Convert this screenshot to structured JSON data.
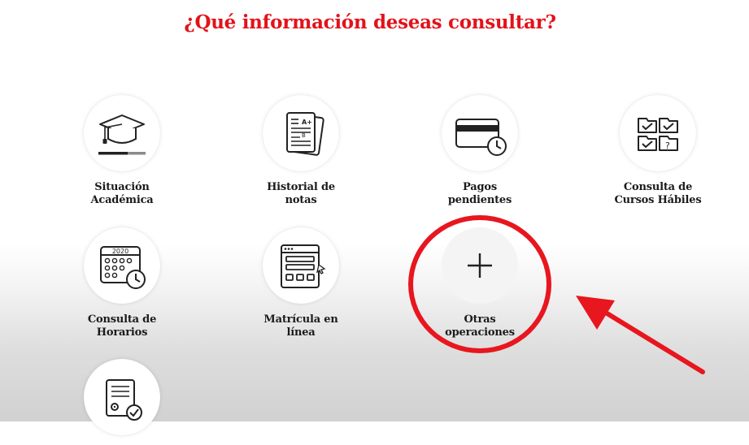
{
  "header": {
    "title": "¿Qué información deseas consultar?"
  },
  "tiles": [
    {
      "label": "Situación\nAcadémica",
      "icon": "graduation-cap-icon"
    },
    {
      "label": "Historial de\nnotas",
      "icon": "document-stack-icon"
    },
    {
      "label": "Pagos\npendientes",
      "icon": "credit-card-clock-icon"
    },
    {
      "label": "Consulta de\nCursos Hábiles",
      "icon": "checklist-folders-icon"
    },
    {
      "label": "Consulta de\nHorarios",
      "icon": "calendar-clock-icon",
      "calendar_year": "2020"
    },
    {
      "label": "Matrícula en\nlínea",
      "icon": "online-form-icon"
    },
    {
      "label": "Otras\noperaciones",
      "icon": "plus-icon"
    },
    {
      "label": "",
      "icon": "document-gear-check-icon"
    }
  ],
  "annotation": {
    "highlight_color": "#e8161e",
    "target": "Otras operaciones"
  },
  "colors": {
    "title": "#e3121a",
    "label": "#1b1b1b"
  }
}
